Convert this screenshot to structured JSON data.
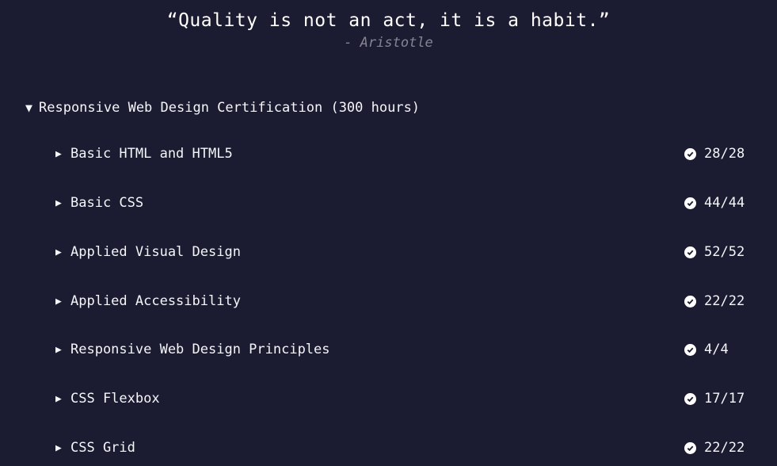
{
  "quote": {
    "text": "“Quality is not an act, it is a habit.”",
    "author": "- Aristotle"
  },
  "superblock": {
    "expanded_arrow": "▼",
    "title": "Responsive Web Design Certification (300 hours)",
    "blocks": [
      {
        "arrow": "▶",
        "title": "Basic HTML and HTML5",
        "progress": "28/28",
        "status_icon": "check-circle-icon"
      },
      {
        "arrow": "▶",
        "title": "Basic CSS",
        "progress": "44/44",
        "status_icon": "check-circle-icon"
      },
      {
        "arrow": "▶",
        "title": "Applied Visual Design",
        "progress": "52/52",
        "status_icon": "check-circle-icon"
      },
      {
        "arrow": "▶",
        "title": "Applied Accessibility",
        "progress": "22/22",
        "status_icon": "check-circle-icon"
      },
      {
        "arrow": "▶",
        "title": "Responsive Web Design Principles",
        "progress": "4/4",
        "status_icon": "check-circle-icon"
      },
      {
        "arrow": "▶",
        "title": "CSS Flexbox",
        "progress": "17/17",
        "status_icon": "check-circle-icon"
      },
      {
        "arrow": "▶",
        "title": "CSS Grid",
        "progress": "22/22",
        "status_icon": "check-circle-icon"
      }
    ]
  },
  "colors": {
    "background": "#1b1b32",
    "text": "#f5f6f7",
    "author": "#858591"
  }
}
